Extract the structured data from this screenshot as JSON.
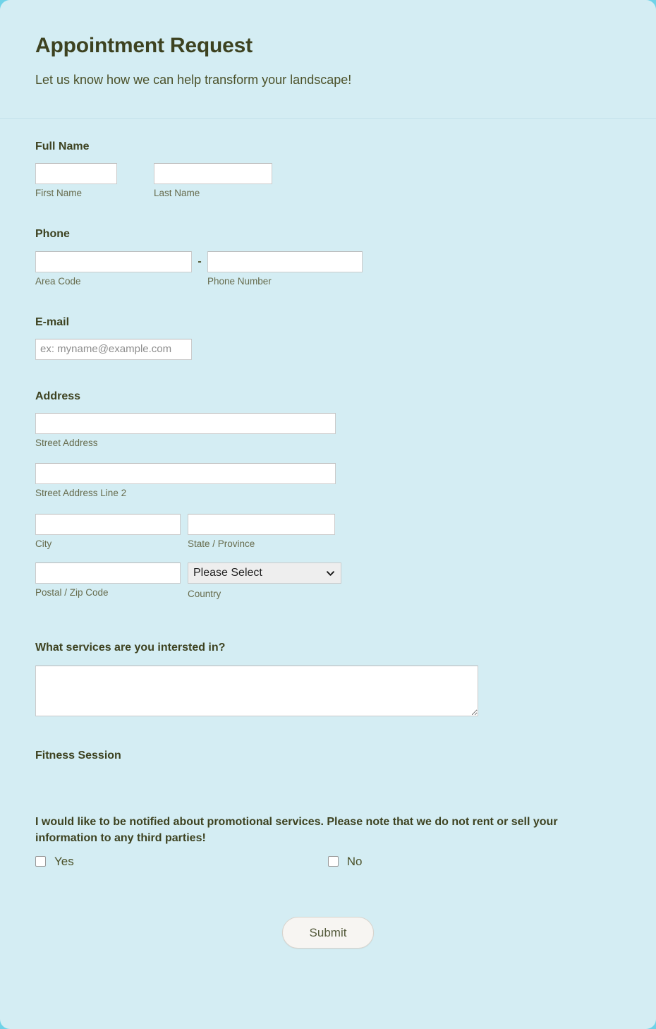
{
  "header": {
    "title": "Appointment Request",
    "subtitle": "Let us know how we can help transform your landscape!"
  },
  "fields": {
    "full_name": {
      "label": "Full Name",
      "first": {
        "sub_label": "First Name",
        "value": "",
        "placeholder": ""
      },
      "last": {
        "sub_label": "Last Name",
        "value": "",
        "placeholder": ""
      }
    },
    "phone": {
      "label": "Phone",
      "separator": "-",
      "area_code": {
        "sub_label": "Area Code",
        "value": "",
        "placeholder": ""
      },
      "number": {
        "sub_label": "Phone Number",
        "value": "",
        "placeholder": ""
      }
    },
    "email": {
      "label": "E-mail",
      "value": "",
      "placeholder": "ex: myname@example.com"
    },
    "address": {
      "label": "Address",
      "street": {
        "sub_label": "Street Address",
        "value": "",
        "placeholder": ""
      },
      "street2": {
        "sub_label": "Street Address Line 2",
        "value": "",
        "placeholder": ""
      },
      "city": {
        "sub_label": "City",
        "value": "",
        "placeholder": ""
      },
      "state": {
        "sub_label": "State / Province",
        "value": "",
        "placeholder": ""
      },
      "postal": {
        "sub_label": "Postal / Zip Code",
        "value": "",
        "placeholder": ""
      },
      "country": {
        "sub_label": "Country",
        "selected": "Please Select",
        "options": [
          "Please Select"
        ],
        "icon": "chevron-down-icon"
      }
    },
    "services": {
      "label": "What services are you intersted in?",
      "value": "",
      "placeholder": ""
    },
    "fitness_session": {
      "label": "Fitness Session"
    },
    "consent": {
      "text": "I would like to be notified about promotional services. Please note that we do not rent or sell your information to any third parties!",
      "options": [
        {
          "label": "Yes",
          "checked": false
        },
        {
          "label": "No",
          "checked": false
        }
      ]
    }
  },
  "actions": {
    "submit_label": "Submit"
  },
  "colors": {
    "page_background": "#6fd3e8",
    "card_background": "#d4edf3",
    "heading_text": "#3d4220",
    "sub_label_text": "#666b4c",
    "input_background": "#ffffff",
    "input_border": "#cbcbcb",
    "select_background": "#eeeeee",
    "submit_background": "#f7f5f2"
  }
}
